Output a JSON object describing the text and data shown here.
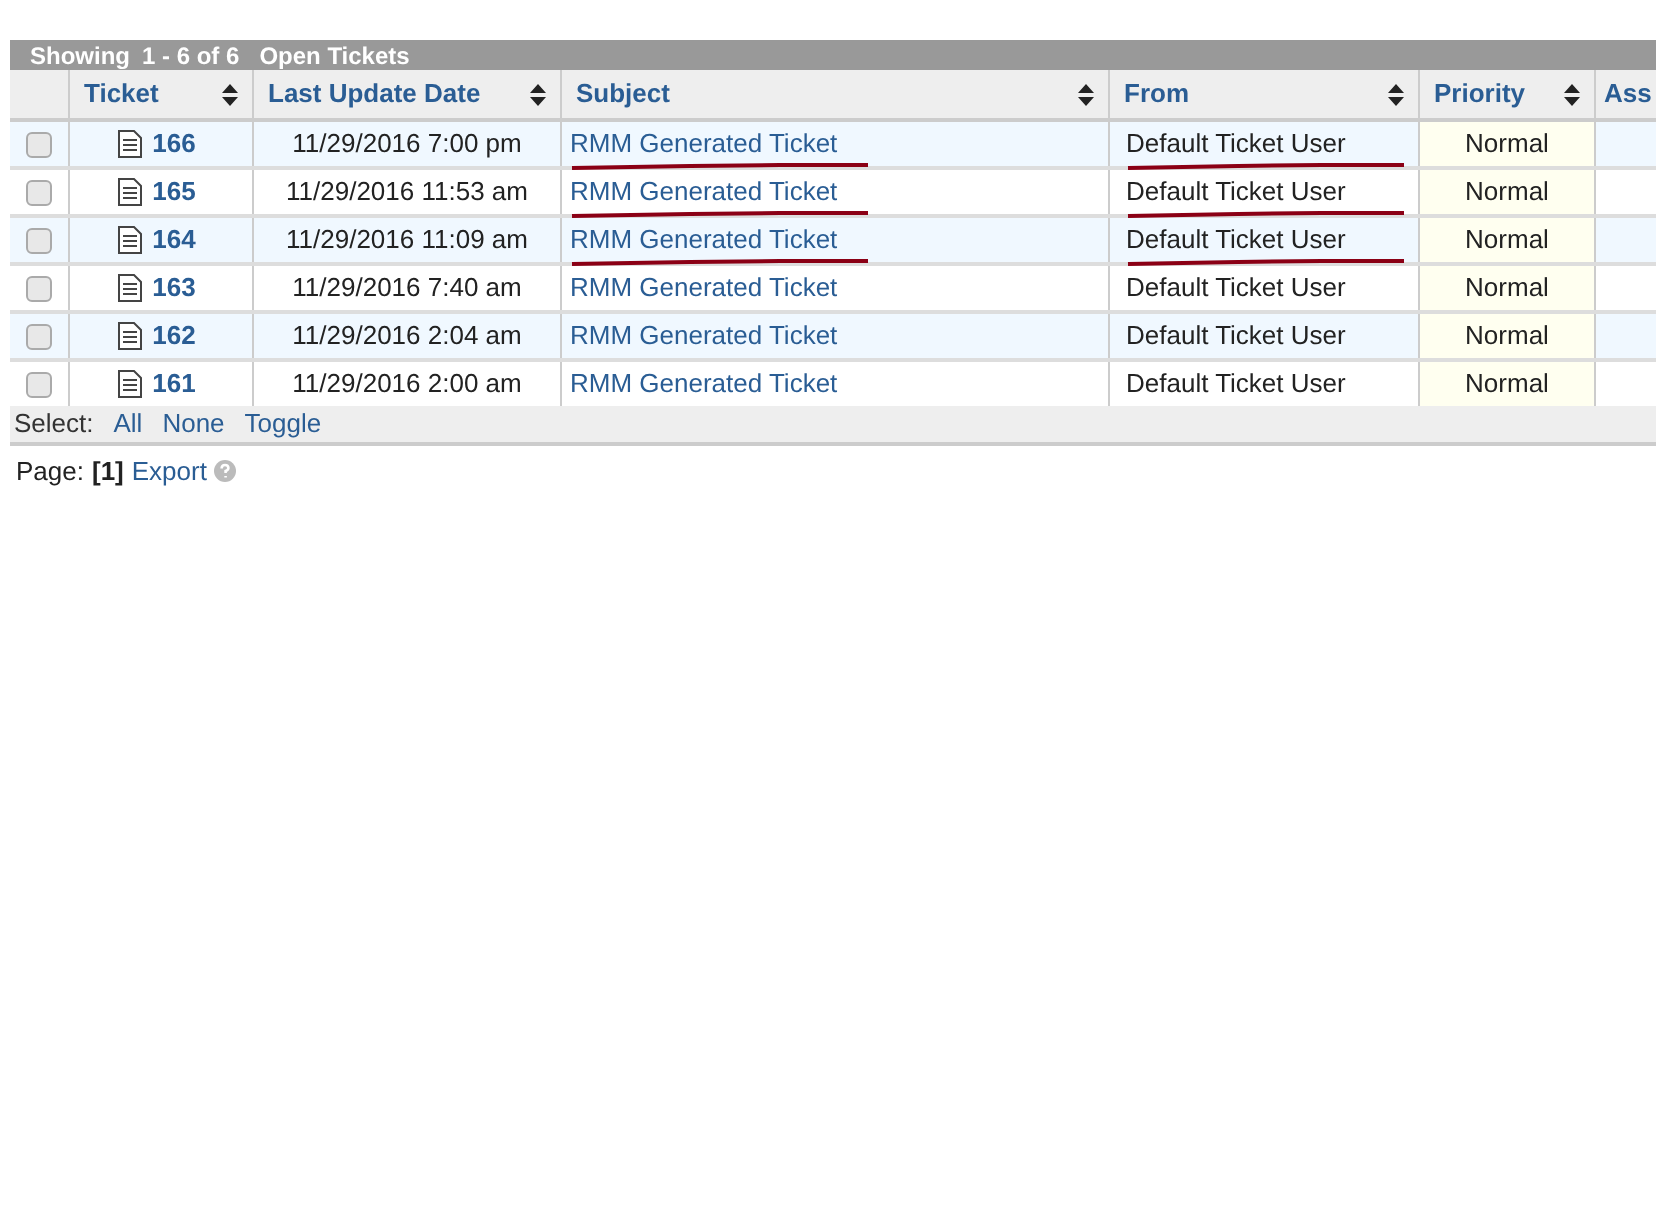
{
  "title_bar": {
    "showing": "Showing",
    "range": "1 - 6 of 6",
    "title": "Open Tickets"
  },
  "columns": [
    {
      "label": "Ticket",
      "sortable": true
    },
    {
      "label": "Last Update Date",
      "sortable": true
    },
    {
      "label": "Subject",
      "sortable": true
    },
    {
      "label": "From",
      "sortable": true
    },
    {
      "label": "Priority",
      "sortable": true
    },
    {
      "label": "Ass"
    }
  ],
  "rows": [
    {
      "checked": false,
      "ticket": "166",
      "date": "11/29/2016 7:00 pm",
      "subject": "RMM Generated Ticket",
      "from": "Default Ticket User",
      "priority": "Normal",
      "marked": true
    },
    {
      "checked": false,
      "ticket": "165",
      "date": "11/29/2016 11:53 am",
      "subject": "RMM Generated Ticket",
      "from": "Default Ticket User",
      "priority": "Normal",
      "marked": true
    },
    {
      "checked": false,
      "ticket": "164",
      "date": "11/29/2016 11:09 am",
      "subject": "RMM Generated Ticket",
      "from": "Default Ticket User",
      "priority": "Normal",
      "marked": true
    },
    {
      "checked": false,
      "ticket": "163",
      "date": "11/29/2016 7:40 am",
      "subject": "RMM Generated Ticket",
      "from": "Default Ticket User",
      "priority": "Normal",
      "marked": false
    },
    {
      "checked": false,
      "ticket": "162",
      "date": "11/29/2016 2:04 am",
      "subject": "RMM Generated Ticket",
      "from": "Default Ticket User",
      "priority": "Normal",
      "marked": false
    },
    {
      "checked": false,
      "ticket": "161",
      "date": "11/29/2016 2:00 am",
      "subject": "RMM Generated Ticket",
      "from": "Default Ticket User",
      "priority": "Normal",
      "marked": false
    }
  ],
  "select_bar": {
    "label": "Select:",
    "links": [
      "All",
      "None",
      "Toggle"
    ]
  },
  "pager": {
    "label": "Page:",
    "current": "[1]",
    "export": "Export"
  }
}
